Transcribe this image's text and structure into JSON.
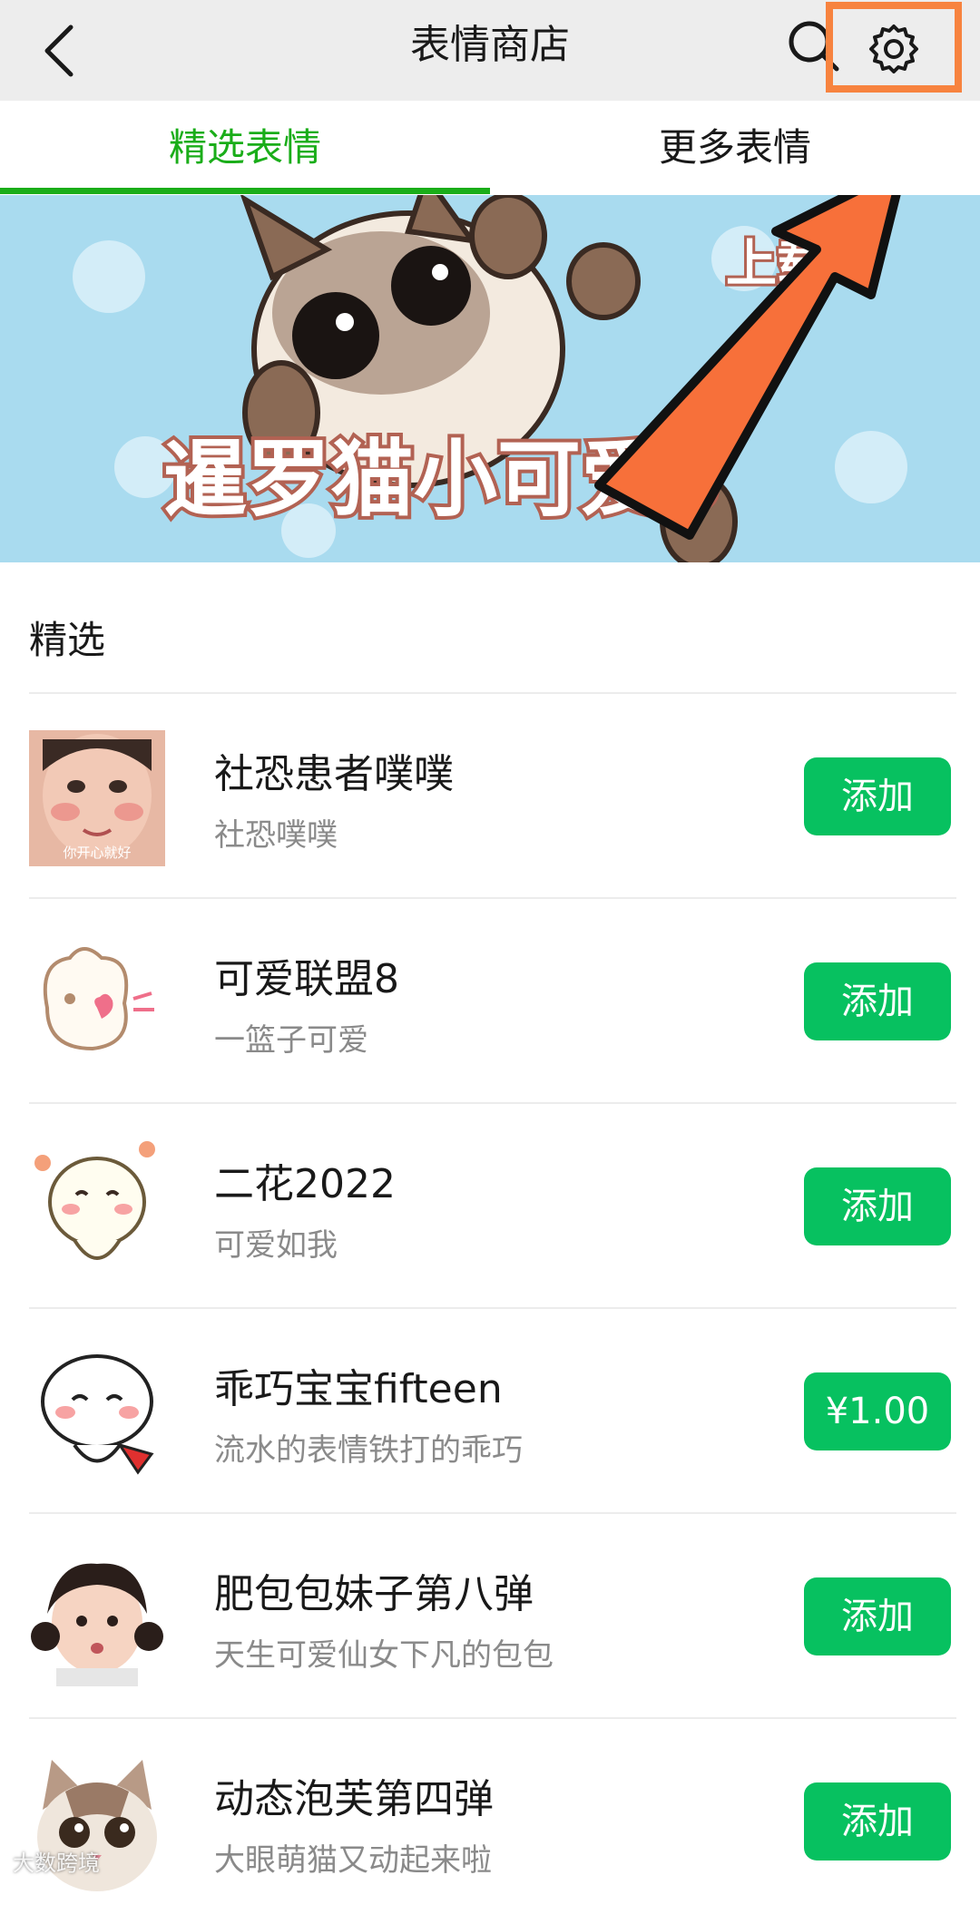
{
  "header": {
    "title": "表情商店",
    "back_icon": "chevron-left-icon",
    "search_icon": "search-icon",
    "settings_icon": "gear-icon",
    "highlight_color": "#f7833f"
  },
  "tabs": [
    {
      "label": "精选表情",
      "active": true
    },
    {
      "label": "更多表情",
      "active": false
    }
  ],
  "accent_color": "#07c160",
  "banner": {
    "title_text": "暹罗猫小可爱3",
    "corner_text": "上载"
  },
  "section": {
    "title": "精选"
  },
  "items": [
    {
      "name": "社恐患者噗噗",
      "desc": "社恐噗噗",
      "action": "添加",
      "thumb_caption": "你开心就好"
    },
    {
      "name": "可爱联盟8",
      "desc": "一篮子可爱",
      "action": "添加"
    },
    {
      "name": "二花2022",
      "desc": "可爱如我",
      "action": "添加"
    },
    {
      "name": "乖巧宝宝fifteen",
      "desc": "流水的表情铁打的乖巧",
      "action": "¥1.00"
    },
    {
      "name": "肥包包妹子第八弹",
      "desc": "天生可爱仙女下凡的包包",
      "action": "添加"
    },
    {
      "name": "动态泡芙第四弹",
      "desc": "大眼萌猫又动起来啦",
      "action": "添加"
    }
  ],
  "watermark": "大数跨境"
}
